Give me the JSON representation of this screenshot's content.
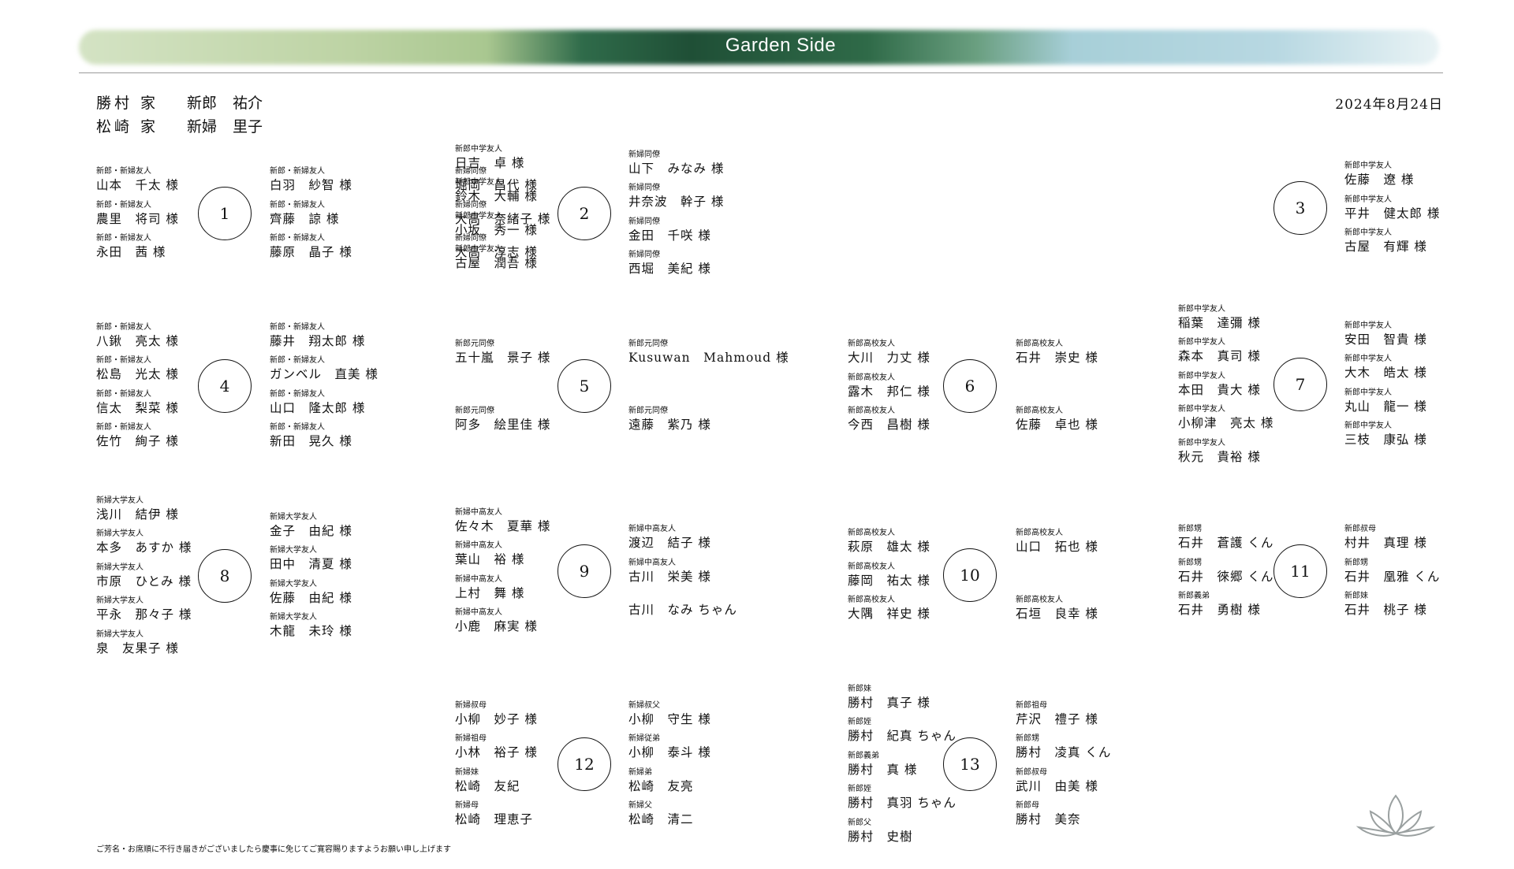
{
  "header": {
    "title": "Garden Side",
    "hosts": [
      {
        "family": "勝村 家",
        "role": "新郎",
        "name": "祐介"
      },
      {
        "family": "松崎 家",
        "role": "新婦",
        "name": "里子"
      }
    ],
    "date": "2024年8月24日"
  },
  "tables": [
    {
      "number": "1",
      "left": [
        [
          "新郎・新婦友人",
          "山本　千太 様"
        ],
        [
          "新郎・新婦友人",
          "農里　将司 様"
        ],
        [
          "新郎・新婦友人",
          "永田　茜 様"
        ]
      ],
      "right": [
        [
          "新郎・新婦友人",
          "白羽　紗智 様"
        ],
        [
          "新郎・新婦友人",
          "齊藤　諒 様"
        ],
        [
          "新郎・新婦友人",
          "藤原　晶子 様"
        ]
      ]
    },
    {
      "number": "2",
      "left": [
        [
          "新婦同僚",
          "堀岡　昌代 様"
        ],
        [
          "新婦同僚",
          "大高　奈緒子 様"
        ],
        [
          "新婦同僚",
          "大高　淳志 様"
        ]
      ],
      "right": [
        [
          "新婦同僚",
          "山下　みなみ 様"
        ],
        [
          "新婦同僚",
          "井奈波　幹子 様"
        ],
        [
          "新婦同僚",
          "金田　千咲 様"
        ],
        [
          "新婦同僚",
          "西堀　美紀 様"
        ]
      ]
    },
    {
      "number": "3",
      "left": [
        [
          "新郎中学友人",
          "日吉　卓 様"
        ],
        [
          "新郎中学友人",
          "鈴木　大輔 様"
        ],
        [
          "新郎中学友人",
          "小坂　秀一 様"
        ],
        [
          "新郎中学友人",
          "古屋　潤吾 様"
        ]
      ],
      "right": [
        [
          "新郎中学友人",
          "佐藤　遼 様"
        ],
        [
          "新郎中学友人",
          "平井　健太郎 様"
        ],
        [
          "新郎中学友人",
          "古屋　有輝 様"
        ]
      ]
    },
    {
      "number": "4",
      "left": [
        [
          "新郎・新婦友人",
          "八鍬　亮太 様"
        ],
        [
          "新郎・新婦友人",
          "松島　光太 様"
        ],
        [
          "新郎・新婦友人",
          "信太　梨菜 様"
        ],
        [
          "新郎・新婦友人",
          "佐竹　絢子 様"
        ]
      ],
      "right": [
        [
          "新郎・新婦友人",
          "藤井　翔太郎 様"
        ],
        [
          "新郎・新婦友人",
          "ガンベル　直美 様"
        ],
        [
          "新郎・新婦友人",
          "山口　隆太郎 様"
        ],
        [
          "新郎・新婦友人",
          "新田　晃久 様"
        ]
      ]
    },
    {
      "number": "5",
      "left": [
        [
          "新郎元同僚",
          "五十嵐　景子 様"
        ],
        [
          "新郎元同僚",
          "阿多　絵里佳 様"
        ]
      ],
      "right": [
        [
          "新郎元同僚",
          "Kusuwan　Mahmoud 様"
        ],
        [
          "新郎元同僚",
          "遠藤　紫乃 様"
        ]
      ]
    },
    {
      "number": "6",
      "left": [
        [
          "新郎高校友人",
          "大川　力丈 様"
        ],
        [
          "新郎高校友人",
          "露木　邦仁 様"
        ],
        [
          "新郎高校友人",
          "今西　昌樹 様"
        ]
      ],
      "right": [
        [
          "新郎高校友人",
          "石井　崇史 様"
        ],
        [
          "新郎高校友人",
          "佐藤　卓也 様"
        ]
      ]
    },
    {
      "number": "7",
      "left": [
        [
          "新郎中学友人",
          "稲葉　達彌 様"
        ],
        [
          "新郎中学友人",
          "森本　真司 様"
        ],
        [
          "新郎中学友人",
          "本田　貴大 様"
        ],
        [
          "新郎中学友人",
          "小柳津　亮太 様"
        ],
        [
          "新郎中学友人",
          "秋元　貴裕 様"
        ]
      ],
      "right": [
        [
          "新郎中学友人",
          "安田　智貴 様"
        ],
        [
          "新郎中学友人",
          "大木　皓太 様"
        ],
        [
          "新郎中学友人",
          "丸山　龍一 様"
        ],
        [
          "新郎中学友人",
          "三枝　康弘 様"
        ]
      ]
    },
    {
      "number": "8",
      "left": [
        [
          "新婦大学友人",
          "浅川　結伊 様"
        ],
        [
          "新婦大学友人",
          "本多　あすか 様"
        ],
        [
          "新婦大学友人",
          "市原　ひとみ 様"
        ],
        [
          "新婦大学友人",
          "平永　那々子 様"
        ],
        [
          "新婦大学友人",
          "泉　友果子 様"
        ]
      ],
      "right": [
        [
          "新婦大学友人",
          "金子　由紀 様"
        ],
        [
          "新婦大学友人",
          "田中　清夏 様"
        ],
        [
          "新婦大学友人",
          "佐藤　由紀 様"
        ],
        [
          "新婦大学友人",
          "木龍　未玲 様"
        ]
      ]
    },
    {
      "number": "9",
      "left": [
        [
          "新婦中高友人",
          "佐々木　夏華 様"
        ],
        [
          "新婦中高友人",
          "葉山　裕 様"
        ],
        [
          "新婦中高友人",
          "上村　舞 様"
        ],
        [
          "新婦中高友人",
          "小鹿　麻実 様"
        ]
      ],
      "right": [
        [
          "新婦中高友人",
          "渡辺　結子 様"
        ],
        [
          "新婦中高友人",
          "古川　栄美 様"
        ],
        [
          "",
          "古川　なみ ちゃん"
        ]
      ]
    },
    {
      "number": "10",
      "left": [
        [
          "新郎高校友人",
          "萩原　雄太 様"
        ],
        [
          "新郎高校友人",
          "藤岡　祐太 様"
        ],
        [
          "新郎高校友人",
          "大隅　祥史 様"
        ]
      ],
      "right": [
        [
          "新郎高校友人",
          "山口　拓也 様"
        ],
        [
          "新郎高校友人",
          "石垣　良幸 様"
        ]
      ]
    },
    {
      "number": "11",
      "left": [
        [
          "新郎甥",
          "石井　蒼護 くん"
        ],
        [
          "新郎甥",
          "石井　徠郷 くん"
        ],
        [
          "新郎義弟",
          "石井　勇樹 様"
        ]
      ],
      "right": [
        [
          "新郎叔母",
          "村井　真理 様"
        ],
        [
          "新郎甥",
          "石井　凰雅 くん"
        ],
        [
          "新郎妹",
          "石井　桃子 様"
        ]
      ]
    },
    {
      "number": "12",
      "left": [
        [
          "新婦叔母",
          "小柳　妙子 様"
        ],
        [
          "新婦祖母",
          "小林　裕子 様"
        ],
        [
          "新婦妹",
          "松崎　友紀"
        ],
        [
          "新婦母",
          "松崎　理恵子"
        ]
      ],
      "right": [
        [
          "新婦叔父",
          "小柳　守生 様"
        ],
        [
          "新婦従弟",
          "小柳　泰斗 様"
        ],
        [
          "新婦弟",
          "松崎　友亮"
        ],
        [
          "新婦父",
          "松崎　清二"
        ]
      ]
    },
    {
      "number": "13",
      "left": [
        [
          "新郎妹",
          "勝村　真子 様"
        ],
        [
          "新郎姪",
          "勝村　紀真 ちゃん"
        ],
        [
          "新郎義弟",
          "勝村　真 様"
        ],
        [
          "新郎姪",
          "勝村　真羽 ちゃん"
        ],
        [
          "新郎父",
          "勝村　史樹"
        ]
      ],
      "right": [
        [
          "新郎祖母",
          "芹沢　禮子 様"
        ],
        [
          "新郎甥",
          "勝村　凌真 くん"
        ],
        [
          "新郎叔母",
          "武川　由美 様"
        ],
        [
          "新郎母",
          "勝村　美奈"
        ]
      ]
    }
  ],
  "footer_note": "ご芳名・お席順に不行き届きがございましたら慶事に免じてご寛容賜りますようお願い申し上げます"
}
